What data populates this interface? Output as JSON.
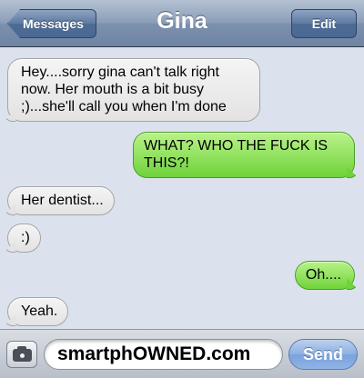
{
  "navbar": {
    "title": "Gina",
    "back_label": "Messages",
    "edit_label": "Edit"
  },
  "messages": [
    {
      "direction": "incoming",
      "text": "Hey....sorry gina can't talk right now. Her mouth is a bit busy ;)...she'll call you when I'm done"
    },
    {
      "direction": "outgoing",
      "text": "WHAT? WHO THE FUCK IS THIS?!"
    },
    {
      "direction": "incoming",
      "text": "Her dentist..."
    },
    {
      "direction": "incoming",
      "text": ":)"
    },
    {
      "direction": "outgoing",
      "text": "Oh...."
    },
    {
      "direction": "incoming",
      "text": "Yeah."
    }
  ],
  "composer": {
    "camera_icon": "camera-icon",
    "field_value": "smartphOWNED.com",
    "send_label": "Send"
  },
  "colors": {
    "incoming_bubble": "#e3e3e3",
    "outgoing_bubble": "#6fd33a",
    "background": "#dbe2ed",
    "send_button": "#8db0e1"
  }
}
